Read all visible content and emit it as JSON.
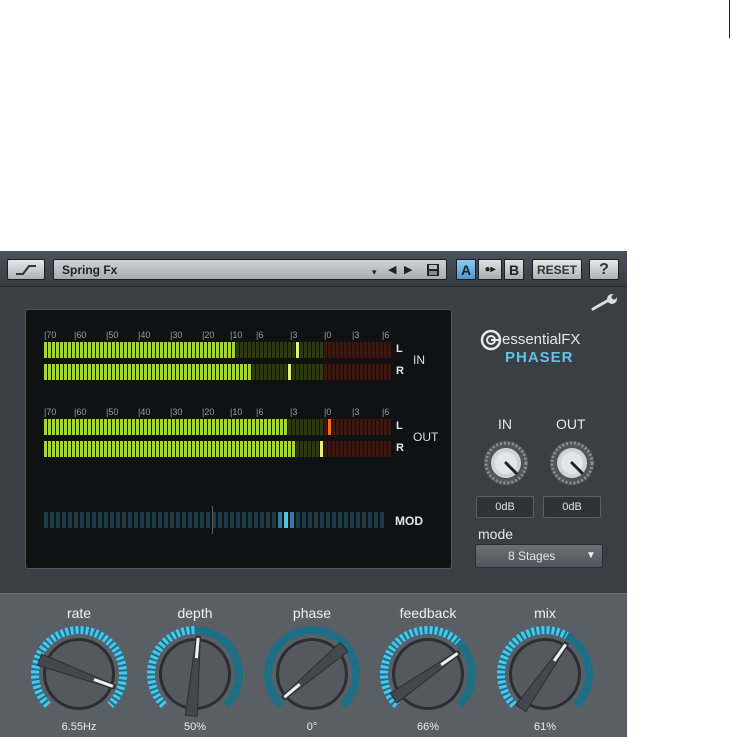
{
  "toolbar": {
    "bypass_icon": "bypass-switch-icon",
    "preset_name": "Spring Fx",
    "dropdown_icon": "▾",
    "prev_icon": "◀",
    "next_icon": "▶",
    "save_icon": "save-icon",
    "ab_a": "A",
    "ab_copy": "●▸",
    "ab_b": "B",
    "reset": "RESET",
    "help": "?"
  },
  "settings_icon": "wrench-icon",
  "meter": {
    "scale_labels": [
      "|70",
      "|60",
      "|50",
      "|40",
      "|30",
      "|20",
      "|10",
      "|6",
      "|3",
      "|0",
      "|3",
      "|6"
    ],
    "in_label": "IN",
    "out_label": "OUT",
    "left_label": "L",
    "right_label": "R",
    "mod_label": "MOD"
  },
  "brand": {
    "name": "essentialFX",
    "product": "PHASER"
  },
  "gain": {
    "in_label": "IN",
    "out_label": "OUT",
    "in_value": "0dB",
    "out_value": "0dB"
  },
  "mode": {
    "label": "mode",
    "value": "8 Stages",
    "arrow": "▼"
  },
  "params": [
    {
      "label": "rate",
      "value": "6.55Hz"
    },
    {
      "label": "depth",
      "value": "50%"
    },
    {
      "label": "phase",
      "value": "0°"
    },
    {
      "label": "feedback",
      "value": "66%"
    },
    {
      "label": "mix",
      "value": "61%"
    }
  ],
  "levels": {
    "in_l": 0.55,
    "in_r": 0.6,
    "out_l": 0.7,
    "out_r": 0.72,
    "mod": 0.72
  },
  "colors": {
    "meter_green": "#a6d636",
    "meter_dim": "#2c3a14",
    "meter_red_dim": "#3a1812",
    "peak_orange": "#ff6a1a",
    "mod_blue": "#4fc3e8",
    "mod_dim": "#1d3a48",
    "accent_blue": "#5fc4e4",
    "ab_active": "#5fa8d8"
  }
}
